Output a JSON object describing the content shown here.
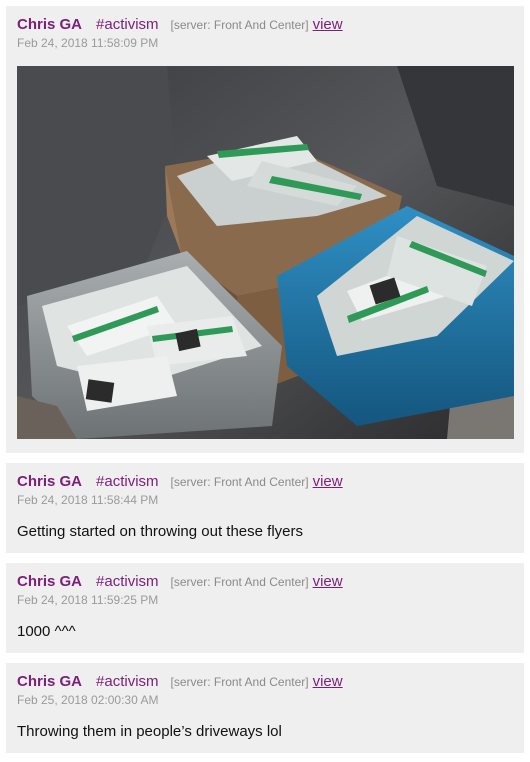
{
  "posts": [
    {
      "author": "Chris GA",
      "channel": "#activism",
      "server": "[server: Front And Center]",
      "view_label": "view",
      "timestamp": "Feb 24, 2018 11:58:09 PM",
      "message": ""
    },
    {
      "author": "Chris GA",
      "channel": "#activism",
      "server": "[server: Front And Center]",
      "view_label": "view",
      "timestamp": "Feb 24, 2018 11:58:44 PM",
      "message": "Getting started on throwing out these flyers"
    },
    {
      "author": "Chris GA",
      "channel": "#activism",
      "server": "[server: Front And Center]",
      "view_label": "view",
      "timestamp": "Feb 24, 2018 11:59:25 PM",
      "message": "1000 ^^^"
    },
    {
      "author": "Chris GA",
      "channel": "#activism",
      "server": "[server: Front And Center]",
      "view_label": "view",
      "timestamp": "Feb 25, 2018 02:00:30 AM",
      "message": "Throwing them in people’s driveways lol"
    }
  ],
  "colors": {
    "link_purple": "#7b1f7b",
    "card_bg": "#efefef",
    "meta_gray": "#9a9a9a"
  }
}
